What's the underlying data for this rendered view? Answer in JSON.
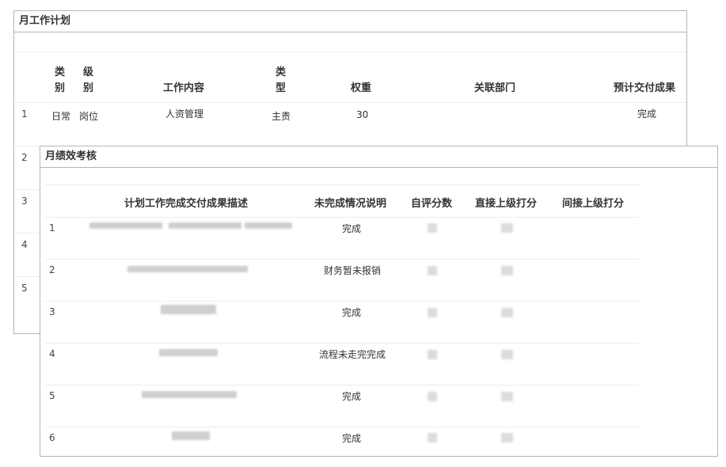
{
  "monthly_plan": {
    "title": "月工作计划",
    "headers": {
      "category": [
        "类",
        "别"
      ],
      "level": [
        "级",
        "别"
      ],
      "content": "工作内容",
      "type": [
        "类",
        "型"
      ],
      "weight": "权重",
      "department": "关联部门",
      "deliverable": "预计交付成果"
    },
    "rows": [
      {
        "index": "1",
        "category": "日常",
        "level": "岗位",
        "content": "人资管理",
        "type": "主责",
        "weight": "30",
        "department": "",
        "deliverable": "完成"
      }
    ],
    "hidden_row_numbers": [
      "2",
      "3",
      "4",
      "5"
    ]
  },
  "monthly_review": {
    "title": "月绩效考核",
    "headers": {
      "description": "计划工作完成交付成果描述",
      "incomplete_note": "未完成情况说明",
      "self_score": "自评分数",
      "direct_score": "直接上级打分",
      "indirect_score": "间接上级打分"
    },
    "rows": [
      {
        "index": "1",
        "status": "完成"
      },
      {
        "index": "2",
        "status": "财务暂未报销"
      },
      {
        "index": "3",
        "status": "完成"
      },
      {
        "index": "4",
        "status": "流程未走完完成"
      },
      {
        "index": "5",
        "status": "完成"
      },
      {
        "index": "6",
        "status": "完成"
      }
    ]
  }
}
